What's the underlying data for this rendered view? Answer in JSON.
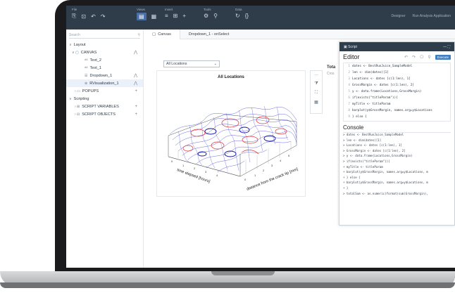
{
  "toolbar": {
    "file_label": "File",
    "views_label": "Views",
    "insert_label": "Insert",
    "tools_label": "Tools",
    "data_label": "Data",
    "right_links": [
      "Designer",
      "Run Analysis Application"
    ]
  },
  "left_panel": {
    "search_placeholder": "Search",
    "tree": [
      {
        "label": "Layout",
        "level": 0
      },
      {
        "label": "CANVAS",
        "level": 1
      },
      {
        "label": "Text_2",
        "level": 2
      },
      {
        "label": "Text_1",
        "level": 2
      },
      {
        "label": "Dropdown_1",
        "level": 2
      },
      {
        "label": "RVisualization_1",
        "level": 2
      },
      {
        "label": "POPUPS",
        "level": 1
      },
      {
        "label": "Scripting",
        "level": 0
      },
      {
        "label": "SCRIPT VARIABLES",
        "level": 1
      },
      {
        "label": "SCRIPT OBJECTS",
        "level": 1
      }
    ]
  },
  "tabs": [
    "Canvas",
    "Dropdown_1 - onSelect"
  ],
  "canvas": {
    "dropdown_value": "All Locations",
    "plot_title": "All Locations",
    "x_axis_label": "distance from the crack tip [mm]",
    "y_axis_label": "time elapsed [hours]",
    "side_label": "Tota",
    "side_sub": "Cros"
  },
  "script": {
    "panel_title": "Script",
    "editor_title": "Editor",
    "execute_label": "Execute",
    "code_lines": [
      "dates <- BestRunJuice_SampleModel",
      "len <- dim(dates)[1]",
      "Locations <- dates [c(1:len), 1]",
      "GrossMargin <- dates [c(1:len), 2]",
      "y <- data.frame(Locations,GrossMargin)",
      "if(exists(\"titleParam\")){",
      "  myTitle <- titleParam",
      "barplot(y$GrossMargin, names.arg=y$Locations",
      "} else {"
    ],
    "console_title": "Console",
    "console_lines": [
      "> dates <- BestRunJuice_SampleModel",
      "> len <- dim(dates)[1]",
      "> Locations <- dates [c(1:len), 1]",
      "> GrossMargin <- dates [c(1:len), 2]",
      "> y <- data.frame(Locations,GrossMargin)",
      "> if(exists(\"titleParam\")){",
      "+   myTitle <- titleParam",
      "+ barplot(y$GrossMargin, names.arg=y$Locations, m",
      "+ } else {",
      "+ barplot(y$GrossMargin, names.arg=y$Locations, m",
      "+ }",
      "> totalSum <- as.numeric(format(sum(GrossMargin),"
    ]
  }
}
